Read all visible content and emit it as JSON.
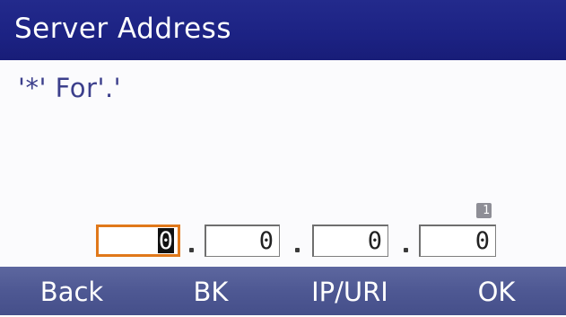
{
  "title": "Server Address",
  "hint": "'*' For'.'",
  "page_indicator": "1",
  "address": {
    "octets": [
      "0",
      "0",
      "0",
      "0"
    ],
    "active_index": 0
  },
  "softkeys": {
    "back": "Back",
    "bk": "BK",
    "ip_uri": "IP/URI",
    "ok": "OK"
  },
  "colors": {
    "title_bar": "#1c2283",
    "softkey_bar": "#4e5893",
    "active_field_border": "#e0781a",
    "hint_text": "#3c3f8c"
  }
}
